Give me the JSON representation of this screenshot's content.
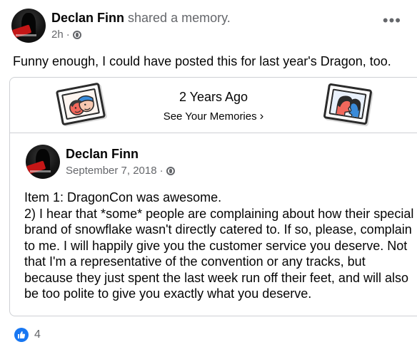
{
  "post": {
    "author": "Declan Finn",
    "action": "shared a memory.",
    "time": "2h",
    "separator": "·",
    "audience_icon": "globe-icon",
    "more_icon": "more-options-icon",
    "text": "Funny enough, I could have posted this for last year's Dragon, too."
  },
  "memory": {
    "years_ago": "2 Years Ago",
    "see_memories": "See Your Memories",
    "chevron": "›"
  },
  "original": {
    "author": "Declan Finn",
    "date": "September 7, 2018",
    "separator": "·",
    "audience_icon": "globe-icon",
    "lines": [
      "Item 1: DragonCon was awesome.",
      "2) I hear that *some* people are complaining about how their special brand of snowflake wasn't directly catered to. If so, please, complain to me. I will happily give you the customer service you deserve. Not that I'm a representative of the convention or any tracks, but because they just spent the last week run off their feet, and will also be too polite to give you exactly what you deserve."
    ]
  },
  "reactions": {
    "icon": "like-icon",
    "count": "4"
  },
  "colors": {
    "secondary_text": "#65676b",
    "like_blue": "#1877f2",
    "border": "#ced0d4"
  }
}
